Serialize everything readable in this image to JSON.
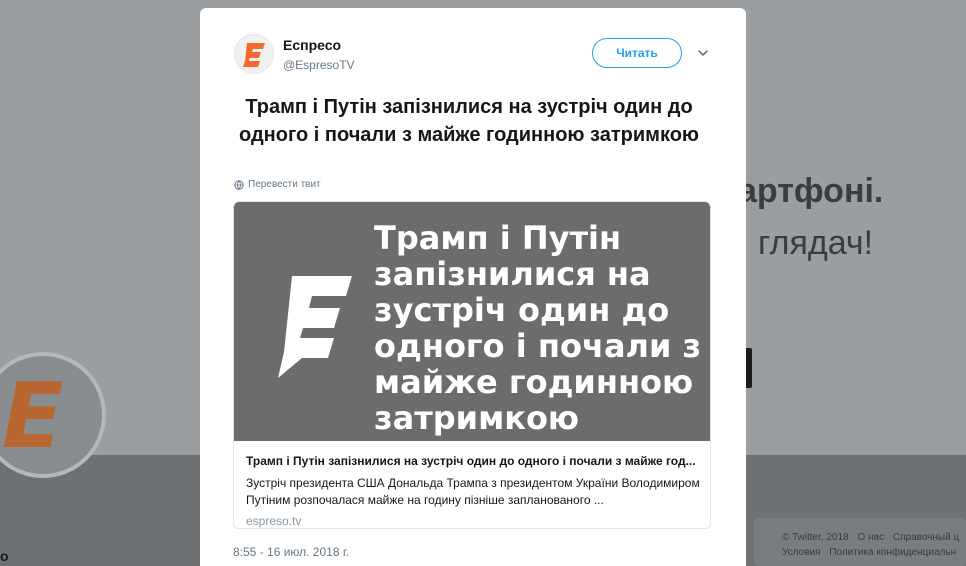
{
  "background": {
    "headline_line1": "артфоні.",
    "headline_line2": "глядач!",
    "profile_letter": "о",
    "footer_row1": [
      "© Twitter, 2018",
      "О нас",
      "Справочный ц"
    ],
    "footer_row2": [
      "Условия",
      "Политика конфиденциальн"
    ]
  },
  "tweet": {
    "author_name": "Еспресо",
    "author_handle": "@EspresoTV",
    "follow_label": "Читать",
    "text": "Трамп і Путін запізнилися на зустріч один до одного і почали з майже годинною затримкою",
    "translate_label": "Перевести твит",
    "timestamp": "8:55 - 16 июл. 2018 г."
  },
  "card": {
    "image_text": "Трамп і Путін запізнилися на зустріч один до одного і почали з майже годинною затримкою",
    "title": "Трамп і Путін запізнилися на зустріч один до одного і почали з майже год...",
    "description": "Зустріч президента США Дональда Трампа з президентом України Володимиром Путіним розпочалася майже на годину пізніше запланованого ...",
    "domain": "espreso.tv"
  },
  "colors": {
    "brand_orange": "#f26a2e",
    "twitter_blue": "#1da1f2",
    "secondary_text": "#657786"
  },
  "icons": {
    "caret": "chevron-down-icon",
    "translate": "globe-icon",
    "logo": "espreso-logo"
  }
}
